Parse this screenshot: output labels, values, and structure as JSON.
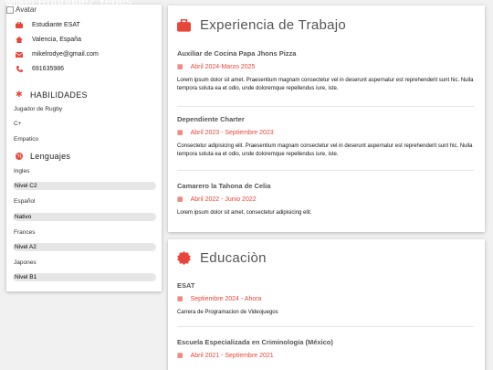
{
  "profile": {
    "name": "Mikel Rodriguez Yedes",
    "avatar_alt": "Avatar",
    "occupation": "Estudiante ESAT",
    "location": "Valencia, España",
    "email": "mikelrodye@gmail.com",
    "phone": "691635986"
  },
  "skills": {
    "title": "HABILIDADES",
    "items": [
      "Jugador de Rugby",
      "C+",
      "Empatico"
    ]
  },
  "languages": {
    "title": "Lenguajes",
    "items": [
      {
        "name": "Ingles",
        "level": "Nivel C2"
      },
      {
        "name": "Español",
        "level": "Nativo"
      },
      {
        "name": "Frances",
        "level": "Nivel A2"
      },
      {
        "name": "Japones",
        "level": "Nivel B1"
      }
    ]
  },
  "experience": {
    "title": "Experiencia de Trabajo",
    "jobs": [
      {
        "title": "Auxiliar de Cocina Papa Jhons Pizza",
        "date": "Abril 2024-Marzo 2025",
        "desc": "Lorem ipsum dolor sit amet. Praesentium magnam consectetur vel in deserunt aspernatur est reprehenderit sunt hic. Nulla tempora soluta ea et odio, unde doloremque repellendus iure, iste."
      },
      {
        "title": "Dependiente Charter",
        "date": "Abril 2023 - Septiembre 2023",
        "desc": "Consectetur adipisicing elit. Praesentium magnam consectetur vel in deserunt aspernatur est reprehenderit sunt hic. Nulla tempora soluta ea et odio, unde doloremque repellendus iure, iste."
      },
      {
        "title": "Camarero la Tahona de Celia",
        "date": "Abril 2022 - Junio 2022",
        "desc": "Lorem ipsum dolor sit amet, consectetur adipisicing elit."
      }
    ]
  },
  "education": {
    "title": "Educaciòn",
    "items": [
      {
        "title": "ESAT",
        "date": "Septiembre 2024 - Ahora",
        "desc": "Carrera de Programacion de Videojuegos"
      },
      {
        "title": "Escuela Especializada en Criminologia (México)",
        "date": "Abril 2021 - Septiembre 2021",
        "desc": ""
      }
    ]
  },
  "colors": {
    "accent": "#e8463a",
    "background": "#f1f1f1",
    "card": "#ffffff"
  }
}
